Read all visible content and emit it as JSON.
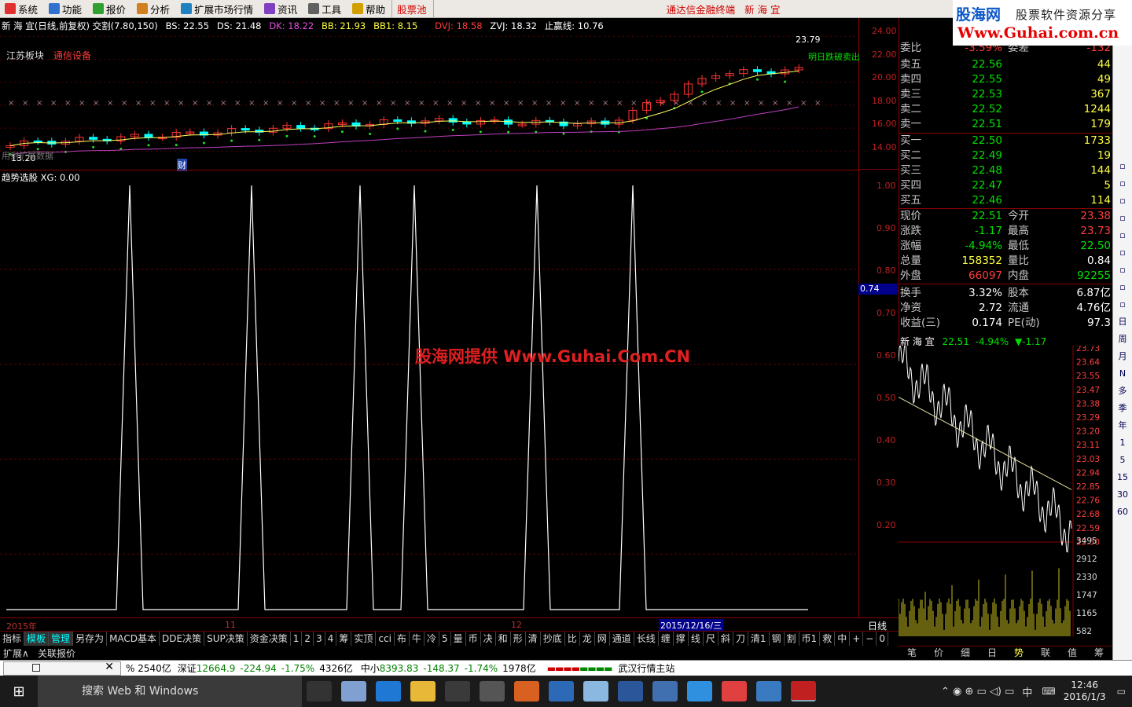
{
  "menu": [
    "系统",
    "功能",
    "报价",
    "分析",
    "扩展市场行情",
    "资讯",
    "工具",
    "帮助",
    "股票池"
  ],
  "title_center": "通达信金融终端",
  "title_stock": "新 海 宜",
  "brand": {
    "line1": "股海网",
    "line1b": "股票软件资源分享",
    "line2": "Www.Guhai.com.cn"
  },
  "chart_header": {
    "name": "新 海 宜(日线,前复权) 交割(7.80,150)",
    "bs": "BS: 22.55",
    "ds": "DS: 21.48",
    "dk": "DK: 18.22",
    "bb": "BB: 21.93",
    "bb1": "BB1: 8.15",
    "dvj": "DVJ: 18.58",
    "zvj": "ZVJ: 18.32",
    "stop": "止赢线: 10.76"
  },
  "sector": "江苏板块",
  "industry": "通信设备",
  "price_axis": [
    "24.00",
    "22.00",
    "20.00",
    "18.00",
    "16.00",
    "14.00"
  ],
  "hi_label": "23.79",
  "lo_label": "13.20",
  "sell_note": "明日跌破卖出",
  "fin_label": "财",
  "indicator_note": "用到扩展数据",
  "lower_header": "趋势选股 XG: 0.00",
  "lower_axis": [
    "1.00",
    "0.90",
    "0.80",
    "0.70",
    "0.60",
    "0.50",
    "0.40",
    "0.30",
    "0.20"
  ],
  "cursor_value": "0.74",
  "watermark": "股海网提供 Www.Guhai.Com.CN",
  "date_labels": {
    "y": "2015年",
    "m11": "11",
    "m12": "12",
    "cur": "2015/12/16/三",
    "period": "日线"
  },
  "order_book": {
    "webi": {
      "k": "委比",
      "v": "-3.59%",
      "k2": "委差",
      "v2": "-132"
    },
    "asks": [
      {
        "k": "卖五",
        "p": "22.56",
        "q": "44"
      },
      {
        "k": "卖四",
        "p": "22.55",
        "q": "49"
      },
      {
        "k": "卖三",
        "p": "22.53",
        "q": "367"
      },
      {
        "k": "卖二",
        "p": "22.52",
        "q": "1244"
      },
      {
        "k": "卖一",
        "p": "22.51",
        "q": "179"
      }
    ],
    "bids": [
      {
        "k": "买一",
        "p": "22.50",
        "q": "1733"
      },
      {
        "k": "买二",
        "p": "22.49",
        "q": "19"
      },
      {
        "k": "买三",
        "p": "22.48",
        "q": "144"
      },
      {
        "k": "买四",
        "p": "22.47",
        "q": "5"
      },
      {
        "k": "买五",
        "p": "22.46",
        "q": "114"
      }
    ]
  },
  "quote": [
    {
      "k": "现价",
      "v": "22.51",
      "k2": "今开",
      "v2": "23.38"
    },
    {
      "k": "涨跌",
      "v": "-1.17",
      "k2": "最高",
      "v2": "23.73"
    },
    {
      "k": "涨幅",
      "v": "-4.94%",
      "k2": "最低",
      "v2": "22.50"
    },
    {
      "k": "总量",
      "v": "158352",
      "k2": "量比",
      "v2": "0.84"
    },
    {
      "k": "外盘",
      "v": "66097",
      "k2": "内盘",
      "v2": "92255"
    },
    {
      "k": "换手",
      "v": "3.32%",
      "k2": "股本",
      "v2": "6.87亿"
    },
    {
      "k": "净资",
      "v": "2.72",
      "k2": "流通",
      "v2": "4.76亿"
    },
    {
      "k": "收益(三)",
      "v": "0.174",
      "k2": "PE(动)",
      "v2": "97.3"
    }
  ],
  "mini": {
    "title": "新 海 宜",
    "price": "22.51",
    "chg": "-4.94%",
    "arrow": "▼",
    "diff": "-1.17",
    "axis": [
      "23.73",
      "23.64",
      "23.55",
      "23.47",
      "23.38",
      "23.29",
      "23.20",
      "23.11",
      "23.03",
      "22.94",
      "22.85",
      "22.76",
      "22.68",
      "22.59",
      "22.50"
    ],
    "vol_axis": [
      "3495",
      "2912",
      "2330",
      "1747",
      "1165",
      "582"
    ]
  },
  "right_side": [
    "日",
    "周",
    "月",
    "N",
    "多",
    "季",
    "年",
    "1",
    "5",
    "15",
    "30",
    "60"
  ],
  "tabs": [
    "指标",
    "模板",
    "管理",
    "另存为",
    "MACD基本",
    "DDE决策",
    "SUP决策",
    "资金决策",
    "1",
    "2",
    "3",
    "4",
    "筹",
    "实顶",
    "cci",
    "布",
    "牛",
    "冷",
    "5",
    "量",
    "币",
    "决",
    "和",
    "形",
    "清",
    "抄底",
    "比",
    "龙",
    "网",
    "通道",
    "长线",
    "缠",
    "撑",
    "线",
    "尺",
    "斜",
    "刀",
    "清1",
    "钢",
    "割",
    "币1",
    "救",
    "中",
    "+",
    "−",
    "0"
  ],
  "tab_row2": [
    "扩展∧",
    "关联报价"
  ],
  "right_tabs": [
    "笔",
    "价",
    "细",
    "日",
    "势",
    "联",
    "值",
    "筹"
  ],
  "status": {
    "a": "% 2540亿",
    "b": "深证",
    "c": "12664.9",
    "d": "-224.94",
    "e": "-1.75%",
    "f": "4326亿",
    "g": "中小",
    "h": "8393.83",
    "i": "-148.37",
    "j": "-1.74%",
    "k": "1978亿",
    "l": "武汉行情主站"
  },
  "taskbar": {
    "search": "搜索 Web 和 Windows",
    "time": "12:46",
    "date": "2016/1/3",
    "ime": "中"
  },
  "colors": {
    "up": "#ff3232",
    "down": "#00ffff",
    "ma": "#ffff60",
    "ma2": "#c040c0"
  }
}
